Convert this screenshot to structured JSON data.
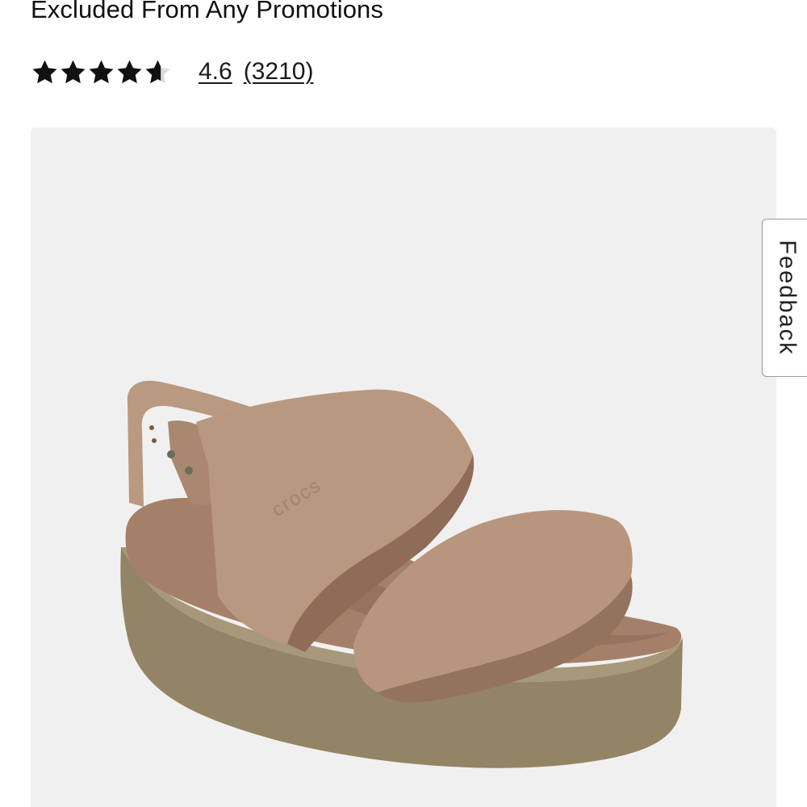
{
  "product": {
    "promo_note": "Excluded From Any Promotions",
    "rating": {
      "value": "4.6",
      "review_count": "(3210)",
      "stars_filled_fraction": 0.92,
      "stars_total": 5
    },
    "image": {
      "icon": "sandal-product-photo",
      "background_color": "#f1f0f1",
      "product_color": "#b5937a"
    }
  },
  "feedback": {
    "label": "Feedback"
  }
}
